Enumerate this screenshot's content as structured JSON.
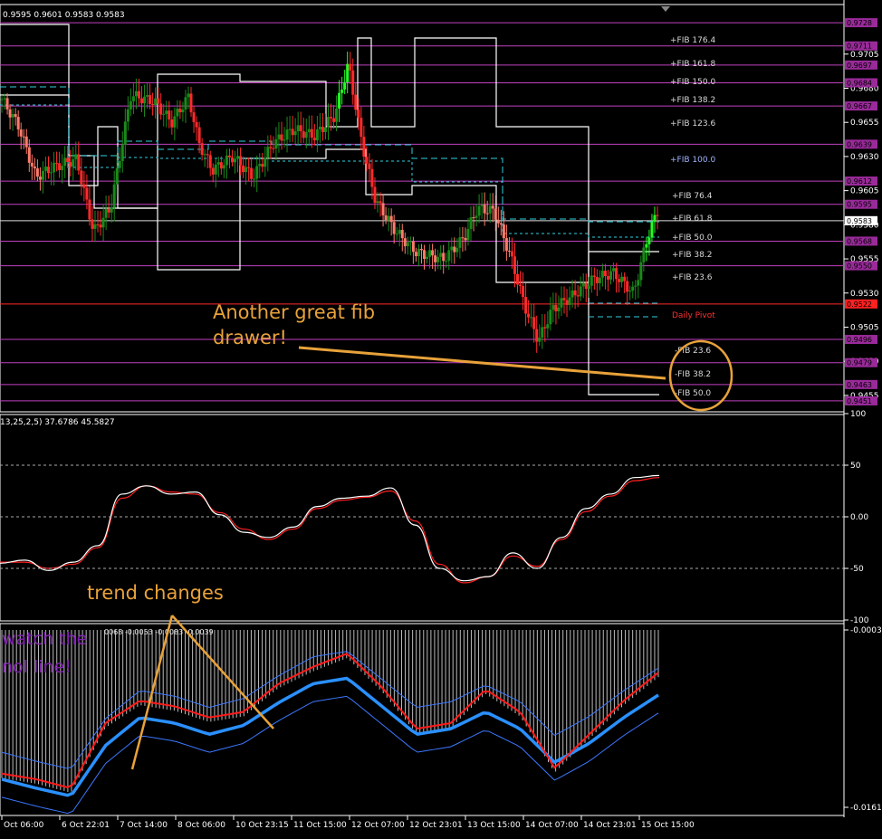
{
  "header": {
    "ohlc": "0.9595 0.9601 0.9583 0.9583",
    "stoch_label": "13,25,2,5) 37.6786 45.5827",
    "macd_label": "0068 -0.0053 -0.0083 -0.0039"
  },
  "colors": {
    "bull": "#1a8a1a",
    "bull_bright": "#22ff22",
    "bear": "#ff2a2a",
    "bear_soft": "#ff7a6a",
    "fib_line": "#c040c0",
    "pivot_line": "#ff2a2a",
    "annotation": "#e8a23a",
    "ma_thick": "#2a90ff",
    "ma_thin": "#3c78ff",
    "macd_signal": "#ff1a1a"
  },
  "price_axis": {
    "ticks": [
      "0.9705",
      "0.9680",
      "0.9655",
      "0.9630",
      "0.9605",
      "0.9580",
      "0.9555",
      "0.9530",
      "0.9505",
      "0.9480",
      "0.9455"
    ],
    "boxes": [
      {
        "label": "0.9728",
        "color": "#b050b0"
      },
      {
        "label": "0.9711",
        "color": "#b050b0"
      },
      {
        "label": "0.9697",
        "color": "#b050b0"
      },
      {
        "label": "0.9684",
        "color": "#b050b0"
      },
      {
        "label": "0.9667",
        "color": "#b050b0"
      },
      {
        "label": "0.9639",
        "color": "#b050b0"
      },
      {
        "label": "0.9612",
        "color": "#b050b0"
      },
      {
        "label": "0.9595",
        "color": "#b050b0"
      },
      {
        "label": "0.9583",
        "color": "#ffffff"
      },
      {
        "label": "0.9568",
        "color": "#b050b0"
      },
      {
        "label": "0.9550",
        "color": "#b050b0"
      },
      {
        "label": "0.9522",
        "color": "#ff3030"
      },
      {
        "label": "0.9496",
        "color": "#b050b0"
      },
      {
        "label": "0.9479",
        "color": "#b050b0"
      },
      {
        "label": "0.9463",
        "color": "#b050b0"
      },
      {
        "label": "0.9451",
        "color": "#b050b0"
      }
    ]
  },
  "fib_labels": [
    {
      "text": "+FIB 176.4"
    },
    {
      "text": "+FIB 161.8"
    },
    {
      "text": "+FIB 150.0"
    },
    {
      "text": "+FIB 138.2"
    },
    {
      "text": "+FIB 123.6"
    },
    {
      "text": "+FIB 100.0"
    },
    {
      "text": "+FIB 76.4"
    },
    {
      "text": "+FIB 61.8"
    },
    {
      "text": "+FIB 50.0"
    },
    {
      "text": "+FIB 38.2"
    },
    {
      "text": "+FIB 23.6"
    },
    {
      "text": "Daily Pivot"
    },
    {
      "text": "-FIB 23.6"
    },
    {
      "text": "-FIB 38.2"
    },
    {
      "text": "-FIB 50.0"
    }
  ],
  "annotations": {
    "fib_note_line1": "Another great fib",
    "fib_note_line2": "drawer!",
    "trend_note": "trend changes",
    "watch_line1": "watch the",
    "watch_line2": "nol line!"
  },
  "stoch_axis": [
    "100",
    "50",
    "0.00",
    "-50",
    "-100"
  ],
  "macd_axis": [
    "-0.0003",
    "-0.0161"
  ],
  "time_axis": [
    "Oct 06:00",
    "6 Oct 22:01",
    "7 Oct 14:00",
    "8 Oct 06:00",
    "10 Oct 23:15",
    "11 Oct 15:00",
    "12 Oct 07:00",
    "12 Oct 23:01",
    "13 Oct 15:00",
    "14 Oct 07:00",
    "14 Oct 23:01",
    "15 Oct 15:00"
  ],
  "chart_data": {
    "type": "line",
    "price_series": [
      {
        "t": 0,
        "c": 0.9672
      },
      {
        "t": 5,
        "c": 0.9652
      },
      {
        "t": 10,
        "c": 0.9615
      },
      {
        "t": 15,
        "c": 0.9622
      },
      {
        "t": 22,
        "c": 0.9628
      },
      {
        "t": 27,
        "c": 0.9575
      },
      {
        "t": 32,
        "c": 0.9592
      },
      {
        "t": 38,
        "c": 0.9675
      },
      {
        "t": 45,
        "c": 0.967
      },
      {
        "t": 50,
        "c": 0.9655
      },
      {
        "t": 55,
        "c": 0.9674
      },
      {
        "t": 58,
        "c": 0.964
      },
      {
        "t": 62,
        "c": 0.962
      },
      {
        "t": 68,
        "c": 0.963
      },
      {
        "t": 74,
        "c": 0.9615
      },
      {
        "t": 80,
        "c": 0.964
      },
      {
        "t": 86,
        "c": 0.965
      },
      {
        "t": 92,
        "c": 0.9645
      },
      {
        "t": 98,
        "c": 0.966
      },
      {
        "t": 102,
        "c": 0.9698
      },
      {
        "t": 106,
        "c": 0.964
      },
      {
        "t": 110,
        "c": 0.9598
      },
      {
        "t": 116,
        "c": 0.9575
      },
      {
        "t": 122,
        "c": 0.956
      },
      {
        "t": 130,
        "c": 0.9555
      },
      {
        "t": 136,
        "c": 0.957
      },
      {
        "t": 140,
        "c": 0.9592
      },
      {
        "t": 145,
        "c": 0.959
      },
      {
        "t": 150,
        "c": 0.9555
      },
      {
        "t": 154,
        "c": 0.952
      },
      {
        "t": 158,
        "c": 0.9495
      },
      {
        "t": 162,
        "c": 0.9518
      },
      {
        "t": 168,
        "c": 0.9528
      },
      {
        "t": 174,
        "c": 0.954
      },
      {
        "t": 180,
        "c": 0.9545
      },
      {
        "t": 186,
        "c": 0.953
      },
      {
        "t": 190,
        "c": 0.957
      },
      {
        "t": 193,
        "c": 0.959
      }
    ],
    "stochastic": {
      "main": [
        -45,
        -42,
        -52,
        -44,
        -28,
        22,
        30,
        22,
        24,
        2,
        -15,
        -20,
        -10,
        10,
        18,
        20,
        28,
        -8,
        -50,
        -62,
        -58,
        -35,
        -50,
        -20,
        8,
        22,
        38,
        40
      ],
      "signal": [
        -44,
        -44,
        -50,
        -46,
        -30,
        18,
        30,
        24,
        22,
        4,
        -12,
        -22,
        -12,
        8,
        16,
        19,
        25,
        -4,
        -46,
        -64,
        -58,
        -38,
        -48,
        -22,
        5,
        20,
        35,
        38
      ]
    },
    "macd": {
      "values": [
        -0.0135,
        -0.014,
        -0.0148,
        -0.009,
        -0.007,
        -0.0075,
        -0.0085,
        -0.008,
        -0.0055,
        -0.004,
        -0.0028,
        -0.0058,
        -0.0095,
        -0.009,
        -0.006,
        -0.008,
        -0.013,
        -0.01,
        -0.007,
        -0.0045
      ],
      "signal": [
        -0.013,
        -0.0138,
        -0.0145,
        -0.01,
        -0.0075,
        -0.008,
        -0.009,
        -0.0082,
        -0.0062,
        -0.0045,
        -0.004,
        -0.0065,
        -0.009,
        -0.0085,
        -0.007,
        -0.0085,
        -0.0115,
        -0.0098,
        -0.0075,
        -0.0055
      ],
      "ylim": [
        -0.0161,
        -0.0003
      ]
    }
  }
}
